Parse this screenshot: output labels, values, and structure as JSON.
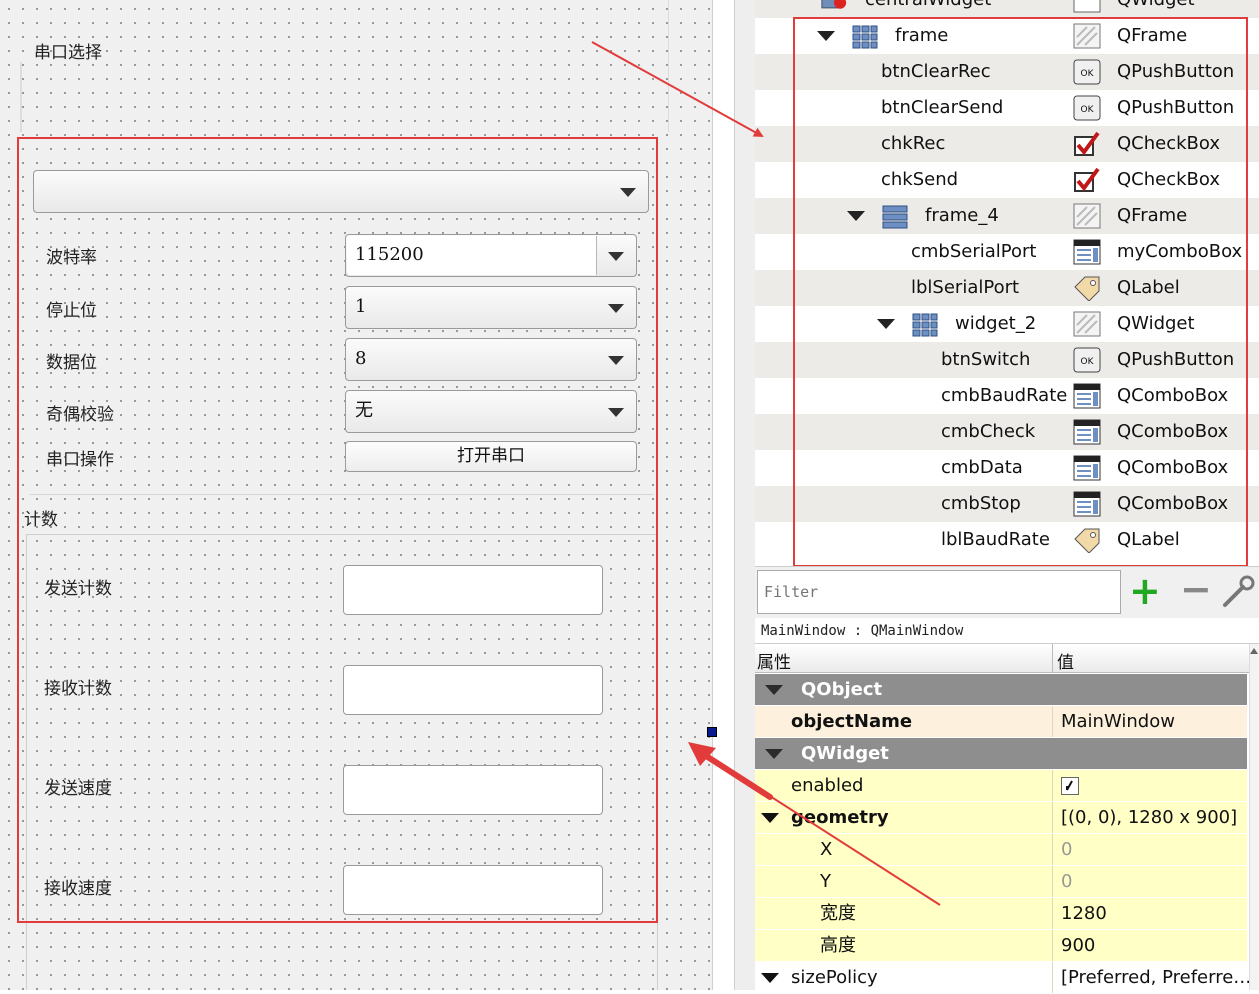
{
  "canvas": {
    "serial_group_label": "串口选择",
    "serial_port_value": "",
    "rows": [
      {
        "label": "波特率",
        "value": "115200",
        "editable": true
      },
      {
        "label": "停止位",
        "value": "1"
      },
      {
        "label": "数据位",
        "value": "8"
      },
      {
        "label": "奇偶校验",
        "value": "无"
      }
    ],
    "operation_label": "串口操作",
    "open_button": "打开串口",
    "count_group_label": "计数",
    "counts": [
      "发送计数",
      "接收计数",
      "发送速度",
      "接收速度"
    ]
  },
  "tree": {
    "partial_top": {
      "name": "centralWidget",
      "class": "QWidget"
    },
    "items": [
      {
        "name": "frame",
        "class": "QFrame",
        "indent": 0,
        "expander": true,
        "icon": "grid-layout-icon",
        "cicon": "frame-icon"
      },
      {
        "name": "btnClearRec",
        "class": "QPushButton",
        "indent": 1,
        "cicon": "push-button-icon"
      },
      {
        "name": "btnClearSend",
        "class": "QPushButton",
        "indent": 1,
        "cicon": "push-button-icon"
      },
      {
        "name": "chkRec",
        "class": "QCheckBox",
        "indent": 1,
        "cicon": "checkbox-icon"
      },
      {
        "name": "chkSend",
        "class": "QCheckBox",
        "indent": 1,
        "cicon": "checkbox-icon"
      },
      {
        "name": "frame_4",
        "class": "QFrame",
        "indent": 1,
        "expander": true,
        "icon": "vertical-layout-icon",
        "cicon": "frame-icon"
      },
      {
        "name": "cmbSerialPort",
        "class": "myComboBox",
        "indent": 2,
        "cicon": "combobox-icon"
      },
      {
        "name": "lblSerialPort",
        "class": "QLabel",
        "indent": 2,
        "cicon": "label-icon"
      },
      {
        "name": "widget_2",
        "class": "QWidget",
        "indent": 2,
        "expander": true,
        "icon": "grid-layout-icon",
        "cicon": "frame-icon"
      },
      {
        "name": "btnSwitch",
        "class": "QPushButton",
        "indent": 3,
        "cicon": "push-button-icon"
      },
      {
        "name": "cmbBaudRate",
        "class": "QComboBox",
        "indent": 3,
        "cicon": "combobox-icon"
      },
      {
        "name": "cmbCheck",
        "class": "QComboBox",
        "indent": 3,
        "cicon": "combobox-icon"
      },
      {
        "name": "cmbData",
        "class": "QComboBox",
        "indent": 3,
        "cicon": "combobox-icon"
      },
      {
        "name": "cmbStop",
        "class": "QComboBox",
        "indent": 3,
        "cicon": "combobox-icon"
      },
      {
        "name": "lblBaudRate",
        "class": "QLabel",
        "indent": 3,
        "cicon": "label-icon"
      }
    ]
  },
  "filter": {
    "placeholder": "Filter",
    "add": "+",
    "remove": "−"
  },
  "object_path": "MainWindow : QMainWindow",
  "properties": {
    "col_property": "属性",
    "col_value": "值",
    "rows": [
      {
        "type": "group",
        "name": "QObject"
      },
      {
        "type": "prop",
        "name": "objectName",
        "value": "MainWindow",
        "bold": true,
        "style": "cream"
      },
      {
        "type": "group",
        "name": "QWidget"
      },
      {
        "type": "prop",
        "name": "enabled",
        "value": "",
        "checkbox": true,
        "style": "yellow"
      },
      {
        "type": "prop",
        "name": "geometry",
        "value": "[(0, 0), 1280 x 900]",
        "bold": true,
        "expander": true,
        "style": "yellow"
      },
      {
        "type": "prop",
        "name": "X",
        "value": "0",
        "sub": true,
        "muted": true,
        "style": "yellow"
      },
      {
        "type": "prop",
        "name": "Y",
        "value": "0",
        "sub": true,
        "muted": true,
        "style": "yellow"
      },
      {
        "type": "prop",
        "name": "宽度",
        "value": "1280",
        "sub": true,
        "style": "yellow"
      },
      {
        "type": "prop",
        "name": "高度",
        "value": "900",
        "sub": true,
        "style": "yellow"
      },
      {
        "type": "prop",
        "name": "sizePolicy",
        "value": "[Preferred, Preferre…",
        "expander": true,
        "style": "white"
      }
    ]
  },
  "colors": {
    "annotation": "#e23b3b",
    "group_header": "#8e8e8e",
    "row_alt": "#ecebe8",
    "property_yellow": "#ffffc6"
  }
}
